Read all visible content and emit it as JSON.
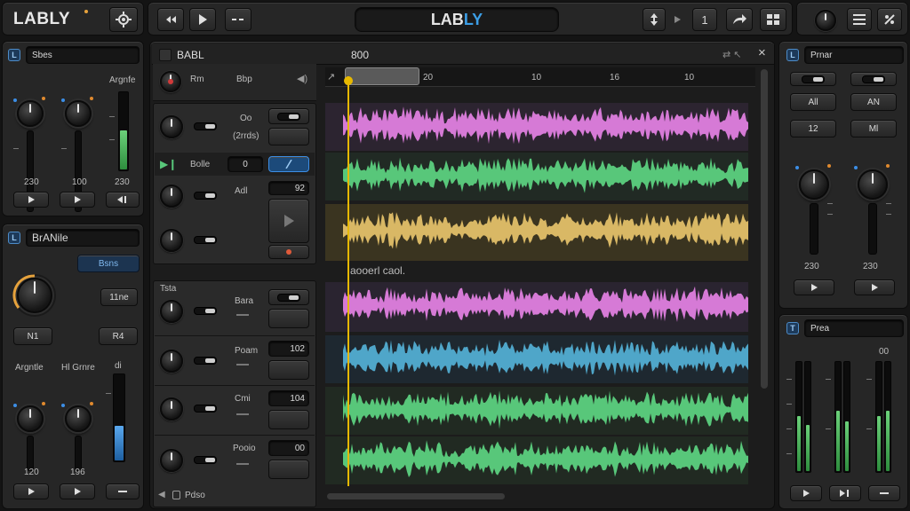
{
  "app": {
    "logo_text": "LABLY",
    "center_title_prefix": "LAB",
    "center_title_suffix": "LY"
  },
  "toolbar": {
    "counter": "1"
  },
  "left_top_panel": {
    "badge": "L",
    "name": "Sbes",
    "section_label": "Argnfe",
    "value_1": "230",
    "value_2": "100",
    "value_3": "230"
  },
  "left_bottom_panel": {
    "badge": "L",
    "name": "BrANile",
    "blue_button": "Bsns",
    "small_button": "11ne",
    "btn_left": "N1",
    "btn_right": "R4",
    "label_1": "Argntle",
    "label_2": "Hl Grnre",
    "label_3": "di",
    "value_1": "120",
    "value_2": "196"
  },
  "tracks_header": {
    "title": "BABL",
    "number": "800",
    "row1_label_a": "Rm",
    "row1_label_b": "Bbp"
  },
  "track_rows": [
    {
      "label": "Oo",
      "sub": "(2rrds)",
      "value": ""
    },
    {
      "label": "Bolle",
      "sub": "",
      "value": "0"
    },
    {
      "label": "Adl",
      "sub": "",
      "value": "92"
    },
    {
      "label": "",
      "sub": "",
      "value": ""
    },
    {
      "label": "Tsta",
      "sub": "",
      "value": ""
    },
    {
      "label": "Bara",
      "sub": "",
      "value": ""
    },
    {
      "label": "Poam",
      "sub": "",
      "value": "102"
    },
    {
      "label": "Cmi",
      "sub": "",
      "value": "104"
    },
    {
      "label": "Pooio",
      "sub": "",
      "value": "00"
    }
  ],
  "timeline": {
    "markers": [
      "20",
      "10",
      "16",
      "10"
    ],
    "section_label": "aooerl caol."
  },
  "bottom_status": {
    "label": "Pdso"
  },
  "right_top_panel": {
    "badge": "L",
    "name": "Prnar",
    "btn_1": "All",
    "btn_2": "AN",
    "btn_3": "12",
    "btn_4": "Ml",
    "value_1": "230",
    "value_2": "230"
  },
  "right_bottom_panel": {
    "badge": "T",
    "name": "Prea",
    "level_label": "00",
    "meter_levels": [
      0.5,
      0.42,
      0.55,
      0.45,
      0.5,
      0.55
    ]
  },
  "colors": {
    "pink": "#d67ad6",
    "green": "#58c77a",
    "yellow": "#d9b865",
    "blue": "#4fa6c9",
    "accent": "#2f8fe8",
    "playhead": "#e6b800"
  }
}
